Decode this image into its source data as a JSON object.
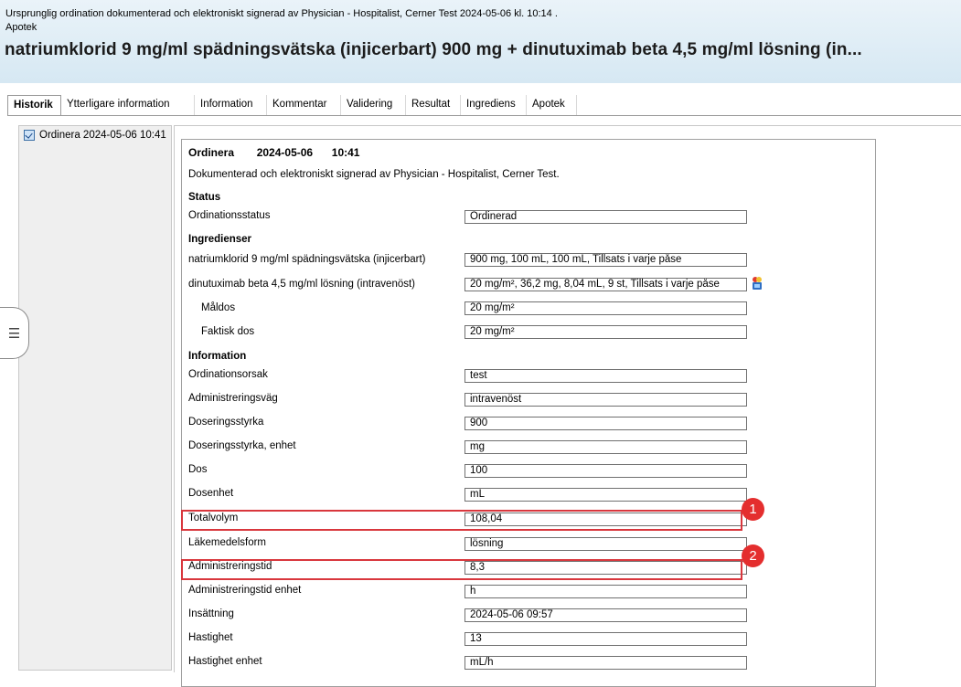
{
  "header": {
    "line1": "Ursprunglig ordination dokumenterad och elektroniskt signerad av Physician - Hospitalist, Cerner Test 2024-05-06 kl. 10:14 .",
    "line2": "Apotek",
    "title": "natriumklorid 9 mg/ml spädningsvätska (injicerbart) 900 mg + dinutuximab beta 4,5 mg/ml lösning (in..."
  },
  "tabs": [
    "Historik",
    "Ytterligare information",
    "Information",
    "Kommentar",
    "Validering",
    "Resultat",
    "Ingrediens",
    "Apotek"
  ],
  "history": {
    "item": "Ordinera 2024-05-06 10:41"
  },
  "doc": {
    "heading_action": "Ordinera",
    "heading_date": "2024-05-06",
    "heading_time": "10:41",
    "signed": "Dokumenterad och elektroniskt signerad av Physician - Hospitalist, Cerner Test.",
    "section_status": "Status",
    "section_ingredients": "Ingredienser",
    "section_information": "Information"
  },
  "fields": {
    "ordinationsstatus": {
      "label": "Ordinationsstatus",
      "value": "Ordinerad"
    },
    "natriumklorid": {
      "label": "natriumklorid 9 mg/ml spädningsvätska (injicerbart)",
      "value": "900 mg, 100 mL, 100 mL, Tillsats i varje påse"
    },
    "dinutuximab": {
      "label": "dinutuximab beta 4,5 mg/ml lösning (intravenöst)",
      "value": "20 mg/m², 36,2 mg, 8,04 mL, 9 st, Tillsats i varje påse"
    },
    "maldos": {
      "label": "Måldos",
      "value": "20 mg/m²"
    },
    "faktisk_dos": {
      "label": "Faktisk dos",
      "value": "20 mg/m²"
    },
    "ordinationsorsak": {
      "label": "Ordinationsorsak",
      "value": "test"
    },
    "administreringsvag": {
      "label": "Administreringsväg",
      "value": "intravenöst"
    },
    "doseringsstyrka": {
      "label": "Doseringsstyrka",
      "value": "900"
    },
    "doseringsstyrka_enhet": {
      "label": "Doseringsstyrka, enhet",
      "value": "mg"
    },
    "dos": {
      "label": "Dos",
      "value": "100"
    },
    "dosenhet": {
      "label": "Dosenhet",
      "value": "mL"
    },
    "totalvolym": {
      "label": "Totalvolym",
      "value": "108,04"
    },
    "lakemedelsform": {
      "label": "Läkemedelsform",
      "value": "lösning"
    },
    "administreringstid": {
      "label": "Administreringstid",
      "value": "8,3"
    },
    "administreringstid_enhet": {
      "label": "Administreringstid enhet",
      "value": "h"
    },
    "insattning": {
      "label": "Insättning",
      "value": "2024-05-06 09:57"
    },
    "hastighet": {
      "label": "Hastighet",
      "value": "13"
    },
    "hastighet_enhet": {
      "label": "Hastighet enhet",
      "value": "mL/h"
    }
  },
  "annotations": {
    "badge1": "1",
    "badge2": "2",
    "color": "#e42e2e"
  },
  "icons": {
    "collapse_handle": "vertical-bars-icon",
    "med_info": "medication-info-icon",
    "history_item": "checkbox-icon"
  }
}
